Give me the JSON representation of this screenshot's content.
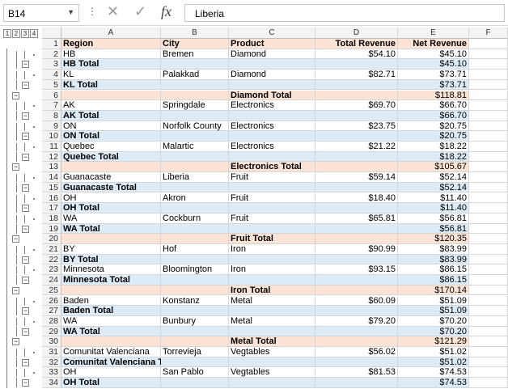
{
  "formula_bar": {
    "name_box": "B14",
    "content": "Liberia",
    "fx_label": "fx"
  },
  "outline_levels": [
    "1",
    "2",
    "3",
    "4"
  ],
  "columns": [
    "A",
    "B",
    "C",
    "D",
    "E",
    "F"
  ],
  "rows": [
    {
      "n": "1",
      "a": "Region",
      "b": "City",
      "c": "Product",
      "d": "Total Revenue",
      "e": "Net Revenue",
      "kind": "header"
    },
    {
      "n": "2",
      "a": "HB",
      "b": "Bremen",
      "c": "Diamond",
      "d": "$54.10",
      "e": "$45.10",
      "kind": "data"
    },
    {
      "n": "3",
      "a": "HB Total",
      "b": "",
      "c": "",
      "d": "",
      "e": "$45.10",
      "kind": "sub"
    },
    {
      "n": "4",
      "a": "KL",
      "b": "Palakkad",
      "c": "Diamond",
      "d": "$82.71",
      "e": "$73.71",
      "kind": "data"
    },
    {
      "n": "5",
      "a": "KL Total",
      "b": "",
      "c": "",
      "d": "",
      "e": "$73.71",
      "kind": "sub"
    },
    {
      "n": "6",
      "a": "",
      "b": "",
      "c": "Diamond Total",
      "d": "",
      "e": "$118.81",
      "kind": "grand"
    },
    {
      "n": "7",
      "a": "AK",
      "b": "Springdale",
      "c": "Electronics",
      "d": "$69.70",
      "e": "$66.70",
      "kind": "data"
    },
    {
      "n": "8",
      "a": "AK Total",
      "b": "",
      "c": "",
      "d": "",
      "e": "$66.70",
      "kind": "sub"
    },
    {
      "n": "9",
      "a": "ON",
      "b": "Norfolk County",
      "c": "Electronics",
      "d": "$23.75",
      "e": "$20.75",
      "kind": "data"
    },
    {
      "n": "10",
      "a": "ON Total",
      "b": "",
      "c": "",
      "d": "",
      "e": "$20.75",
      "kind": "sub"
    },
    {
      "n": "11",
      "a": "Quebec",
      "b": "Malartic",
      "c": "Electronics",
      "d": "$21.22",
      "e": "$18.22",
      "kind": "data"
    },
    {
      "n": "12",
      "a": "Quebec Total",
      "b": "",
      "c": "",
      "d": "",
      "e": "$18.22",
      "kind": "sub"
    },
    {
      "n": "13",
      "a": "",
      "b": "",
      "c": "Electronics Total",
      "d": "",
      "e": "$105.67",
      "kind": "grand"
    },
    {
      "n": "14",
      "a": "Guanacaste",
      "b": "Liberia",
      "c": "Fruit",
      "d": "$59.14",
      "e": "$52.14",
      "kind": "data"
    },
    {
      "n": "15",
      "a": "Guanacaste Total",
      "b": "",
      "c": "",
      "d": "",
      "e": "$52.14",
      "kind": "sub"
    },
    {
      "n": "16",
      "a": "OH",
      "b": "Akron",
      "c": "Fruit",
      "d": "$18.40",
      "e": "$11.40",
      "kind": "data"
    },
    {
      "n": "17",
      "a": "OH Total",
      "b": "",
      "c": "",
      "d": "",
      "e": "$11.40",
      "kind": "sub"
    },
    {
      "n": "18",
      "a": "WA",
      "b": "Cockburn",
      "c": "Fruit",
      "d": "$65.81",
      "e": "$56.81",
      "kind": "data"
    },
    {
      "n": "19",
      "a": "WA Total",
      "b": "",
      "c": "",
      "d": "",
      "e": "$56.81",
      "kind": "sub"
    },
    {
      "n": "20",
      "a": "",
      "b": "",
      "c": "Fruit Total",
      "d": "",
      "e": "$120.35",
      "kind": "grand"
    },
    {
      "n": "21",
      "a": "BY",
      "b": "Hof",
      "c": "Iron",
      "d": "$90.99",
      "e": "$83.99",
      "kind": "data"
    },
    {
      "n": "22",
      "a": "BY Total",
      "b": "",
      "c": "",
      "d": "",
      "e": "$83.99",
      "kind": "sub"
    },
    {
      "n": "23",
      "a": "Minnesota",
      "b": "Bloomington",
      "c": "Iron",
      "d": "$93.15",
      "e": "$86.15",
      "kind": "data"
    },
    {
      "n": "24",
      "a": "Minnesota Total",
      "b": "",
      "c": "",
      "d": "",
      "e": "$86.15",
      "kind": "sub"
    },
    {
      "n": "25",
      "a": "",
      "b": "",
      "c": "Iron Total",
      "d": "",
      "e": "$170.14",
      "kind": "grand"
    },
    {
      "n": "26",
      "a": "Baden",
      "b": "Konstanz",
      "c": "Metal",
      "d": "$60.09",
      "e": "$51.09",
      "kind": "data"
    },
    {
      "n": "27",
      "a": "Baden Total",
      "b": "",
      "c": "",
      "d": "",
      "e": "$51.09",
      "kind": "sub"
    },
    {
      "n": "28",
      "a": "WA",
      "b": "Bunbury",
      "c": "Metal",
      "d": "$79.20",
      "e": "$70.20",
      "kind": "data"
    },
    {
      "n": "29",
      "a": "WA Total",
      "b": "",
      "c": "",
      "d": "",
      "e": "$70.20",
      "kind": "sub"
    },
    {
      "n": "30",
      "a": "",
      "b": "",
      "c": "Metal Total",
      "d": "",
      "e": "$121.29",
      "kind": "grand"
    },
    {
      "n": "31",
      "a": "Comunitat Valenciana",
      "b": "Torrevieja",
      "c": "Vegtables",
      "d": "$56.02",
      "e": "$51.02",
      "kind": "data"
    },
    {
      "n": "32",
      "a": "Comunitat Valenciana Total",
      "b": "",
      "c": "",
      "d": "",
      "e": "$51.02",
      "kind": "sub"
    },
    {
      "n": "33",
      "a": "OH",
      "b": "San Pablo",
      "c": "Vegtables",
      "d": "$81.53",
      "e": "$74.53",
      "kind": "data"
    },
    {
      "n": "34",
      "a": "OH Total",
      "b": "",
      "c": "",
      "d": "",
      "e": "$74.53",
      "kind": "sub"
    }
  ]
}
